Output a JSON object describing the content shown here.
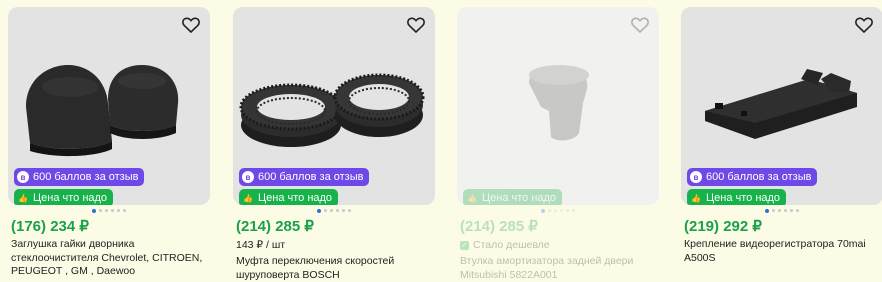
{
  "products": [
    {
      "price_old": "(176)",
      "price": "234 ₽",
      "title": "Заглушка гайки дворника стеклоочистителя Chevrolet, CITROEN, PEUGEOT , GM , Daewoo",
      "badge_points": "600 баллов за отзыв",
      "badge_price": "Цена что надо",
      "image_icon": "wiper-nut-caps",
      "slides": 6,
      "active_slide": 0
    },
    {
      "price_old": "(214)",
      "price": "285 ₽",
      "unit_price": "143 ₽ / шт",
      "title": "Муфта переключения скоростей шуруповерта BOSCH",
      "badge_points": "600 баллов за отзыв",
      "badge_price": "Цена что надо",
      "image_icon": "gear-rings",
      "slides": 6,
      "active_slide": 0
    },
    {
      "price_old": "(214)",
      "price": "285 ₽",
      "note": "Стало дешевле",
      "title": "Втулка амортизатора задней двери Mitsubishi 5822A001",
      "badge_price": "Цена что надо",
      "image_icon": "shock-bushing",
      "slides": 6,
      "active_slide": 0,
      "unavailable": true
    },
    {
      "price_old": "(219)",
      "price": "292 ₽",
      "title": "Крепление видеорегистратора 70mai A500S",
      "badge_points": "600 баллов за отзыв",
      "badge_price": "Цена что надо",
      "image_icon": "dashcam-mount",
      "slides": 6,
      "active_slide": 0
    }
  ],
  "colors": {
    "page_bg": "#fbfbe6",
    "price_green": "#1aa14a",
    "badge_purple": "#6f48e8",
    "badge_green": "#17b24a",
    "dot_active": "#2d6fe0"
  }
}
